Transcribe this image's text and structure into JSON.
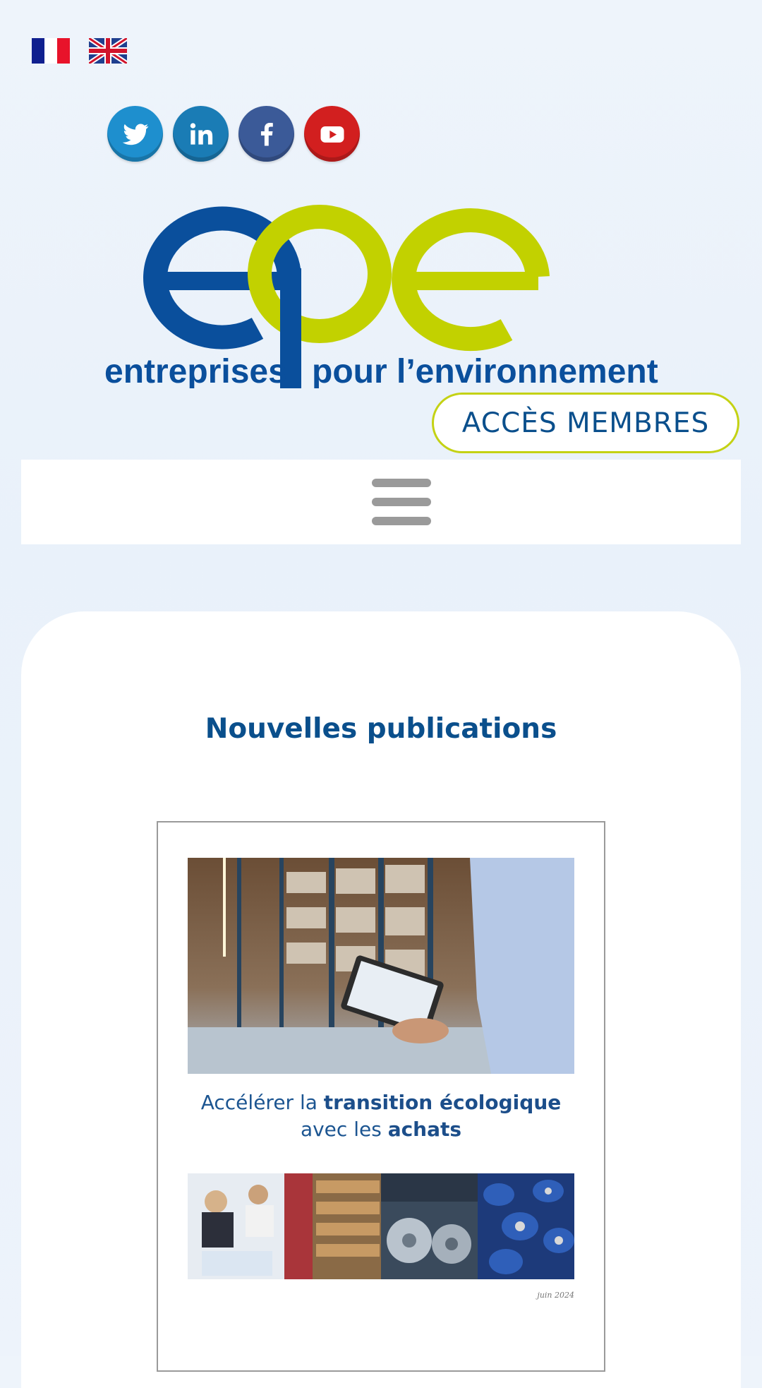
{
  "languages": [
    {
      "code": "fr",
      "icon": "flag-france-icon"
    },
    {
      "code": "en",
      "icon": "flag-uk-icon"
    }
  ],
  "socials": [
    {
      "name": "twitter",
      "icon": "twitter-icon",
      "color": "#1e8fce"
    },
    {
      "name": "linkedin",
      "icon": "linkedin-icon",
      "color": "#1a7cb5"
    },
    {
      "name": "facebook",
      "icon": "facebook-icon",
      "color": "#3b5a98"
    },
    {
      "name": "youtube",
      "icon": "youtube-icon",
      "color": "#d21f1f"
    }
  ],
  "logo": {
    "tagline_left": "entreprises",
    "tagline_right": "pour l’environnement",
    "colors": {
      "blue": "#0a4f9c",
      "green": "#c2d100"
    }
  },
  "header": {
    "member_access_label": "ACCÈS MEMBRES",
    "menu_icon": "hamburger-menu-icon"
  },
  "main": {
    "section_title": "Nouvelles publications",
    "publication": {
      "title_part1": "Accélérer la ",
      "title_bold1": "transition écologique",
      "title_part2": "avec les ",
      "title_bold2": "achats",
      "date": "juin 2024"
    }
  },
  "colors": {
    "brand_blue": "#0a4f8c",
    "accent_green": "#c4d214"
  }
}
